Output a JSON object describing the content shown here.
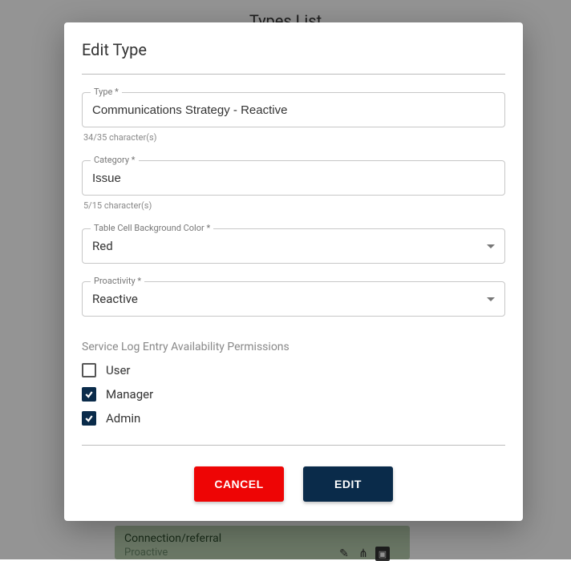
{
  "background": {
    "page_title": "Types List",
    "card_title": "Connection/referral",
    "card_subtitle": "Proactive"
  },
  "dialog": {
    "title": "Edit Type",
    "fields": {
      "type": {
        "label": "Type *",
        "value": "Communications Strategy - Reactive",
        "helper": "34/35 character(s)"
      },
      "category": {
        "label": "Category *",
        "value": "Issue",
        "helper": "5/15 character(s)"
      },
      "bg_color": {
        "label": "Table Cell Background Color *",
        "value": "Red"
      },
      "proactivity": {
        "label": "Proactivity *",
        "value": "Reactive"
      }
    },
    "permissions": {
      "section_label": "Service Log Entry Availability Permissions",
      "items": [
        {
          "label": "User",
          "checked": false
        },
        {
          "label": "Manager",
          "checked": true
        },
        {
          "label": "Admin",
          "checked": true
        }
      ]
    },
    "actions": {
      "cancel": "CANCEL",
      "edit": "EDIT"
    }
  }
}
